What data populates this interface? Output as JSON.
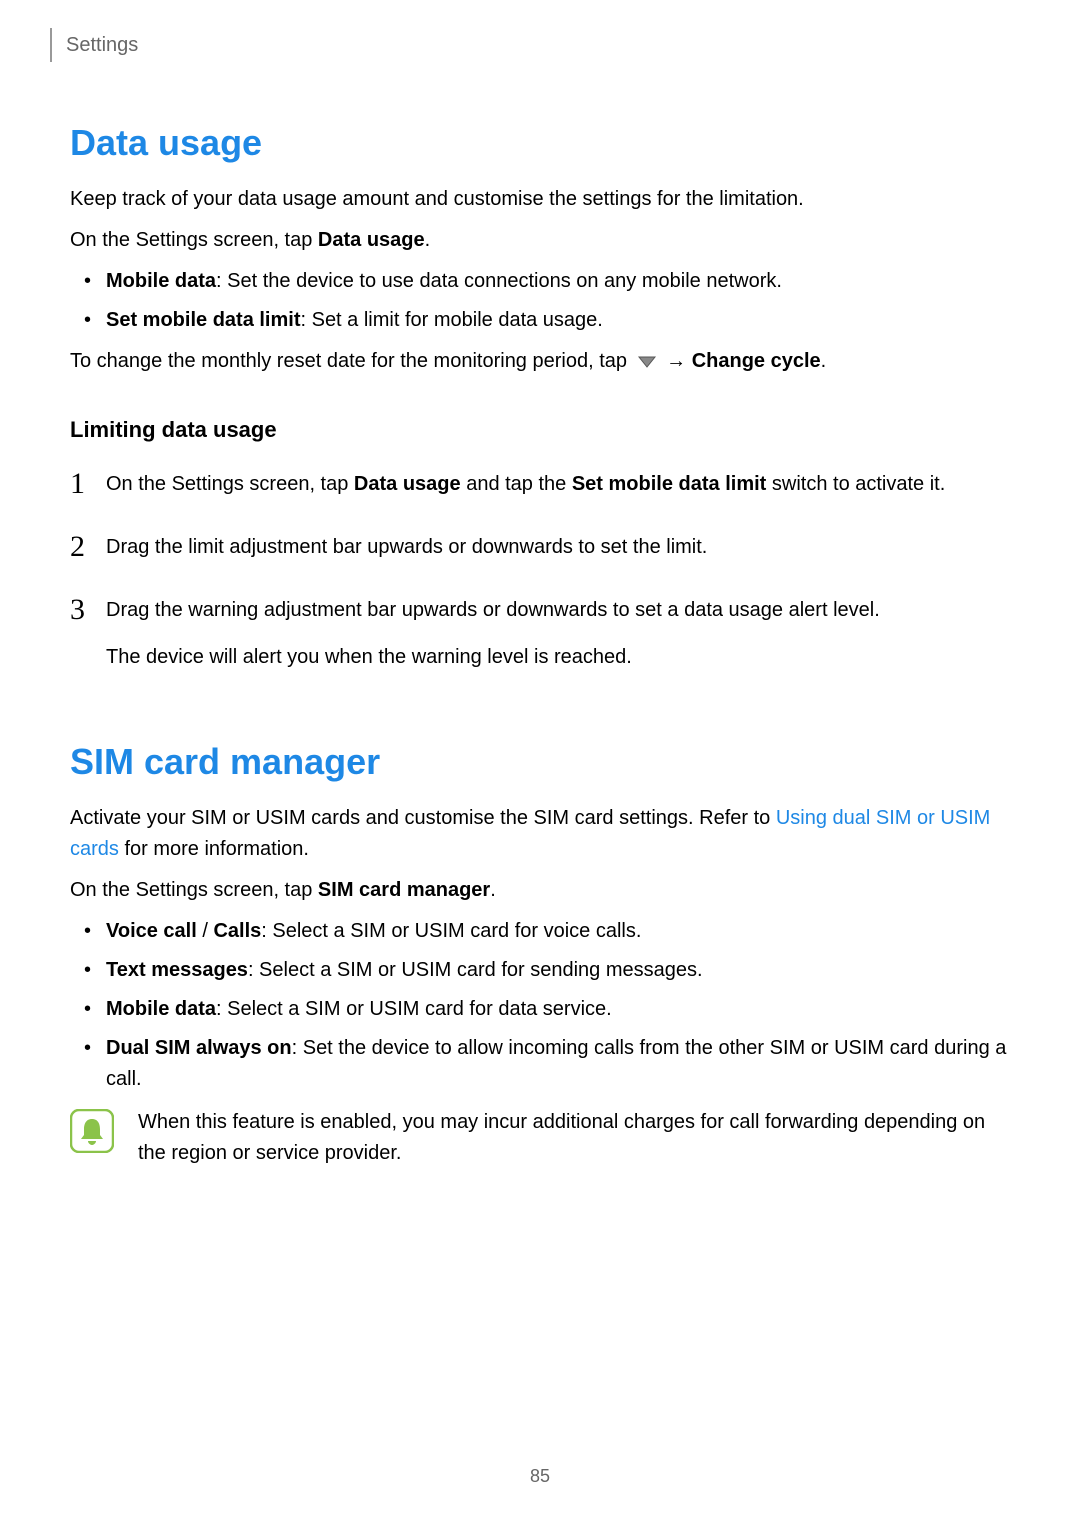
{
  "header": {
    "breadcrumb": "Settings"
  },
  "section1": {
    "heading": "Data usage",
    "intro1": "Keep track of your data usage amount and customise the settings for the limitation.",
    "intro2_pre": "On the Settings screen, tap ",
    "intro2_bold": "Data usage",
    "intro2_post": ".",
    "bullets": [
      {
        "bold": "Mobile data",
        "text": ": Set the device to use data connections on any mobile network."
      },
      {
        "bold": "Set mobile data limit",
        "text": ": Set a limit for mobile data usage."
      }
    ],
    "reset_pre": "To change the monthly reset date for the monitoring period, tap ",
    "reset_arrow": " → ",
    "reset_bold": "Change cycle",
    "reset_post": ".",
    "sub_heading": "Limiting data usage",
    "steps": [
      {
        "num": "1",
        "parts": [
          {
            "t": "On the Settings screen, tap "
          },
          {
            "t": "Data usage",
            "bold": true
          },
          {
            "t": " and tap the "
          },
          {
            "t": "Set mobile data limit",
            "bold": true
          },
          {
            "t": " switch to activate it."
          }
        ]
      },
      {
        "num": "2",
        "parts": [
          {
            "t": "Drag the limit adjustment bar upwards or downwards to set the limit."
          }
        ]
      },
      {
        "num": "3",
        "parts": [
          {
            "t": "Drag the warning adjustment bar upwards or downwards to set a data usage alert level."
          }
        ],
        "sub": "The device will alert you when the warning level is reached."
      }
    ]
  },
  "section2": {
    "heading": "SIM card manager",
    "intro_parts": [
      {
        "t": "Activate your SIM or USIM cards and customise the SIM card settings. Refer to "
      },
      {
        "t": "Using dual SIM or USIM cards",
        "link": true
      },
      {
        "t": " for more information."
      }
    ],
    "intro2_pre": "On the Settings screen, tap ",
    "intro2_bold": "SIM card manager",
    "intro2_post": ".",
    "bullets": [
      {
        "bold": "Voice call",
        "slash": " / ",
        "bold2": "Calls",
        "text": ": Select a SIM or USIM card for voice calls."
      },
      {
        "bold": "Text messages",
        "text": ": Select a SIM or USIM card for sending messages."
      },
      {
        "bold": "Mobile data",
        "text": ": Select a SIM or USIM card for data service."
      },
      {
        "bold": "Dual SIM always on",
        "text": ": Set the device to allow incoming calls from the other SIM or USIM card during a call."
      }
    ],
    "note": "When this feature is enabled, you may incur additional charges for call forwarding depending on the region or service provider."
  },
  "page_number": "85",
  "colors": {
    "accent": "#1e88e5",
    "note_icon": "#8bc34a"
  }
}
